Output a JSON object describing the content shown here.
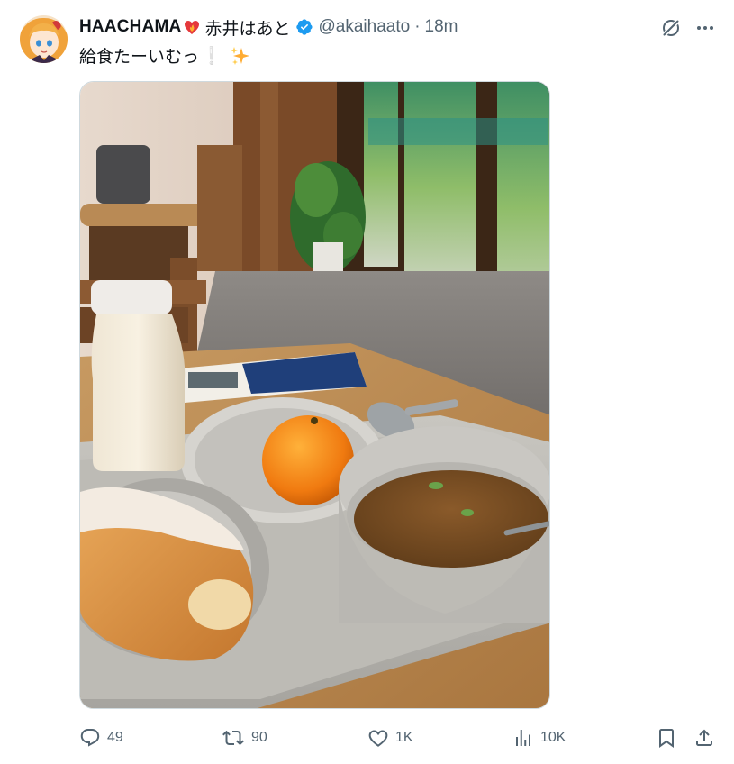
{
  "tweet": {
    "display_name": "HAACHAMA",
    "display_name_jp": "赤井はあと",
    "handle": "@akaihaato",
    "separator": "·",
    "time": "18m",
    "text": "給食たーいむっ",
    "text_exclaim": "❕"
  },
  "media": {
    "kind": "photo",
    "subject": "school-lunch tray with curry, sugared bread, mandarin orange and milk bottle"
  },
  "actions": {
    "replies": "49",
    "reposts": "90",
    "likes": "1K",
    "views": "10K"
  },
  "colors": {
    "text": "#0f1419",
    "secondary": "#536471",
    "verified": "#1d9bf0",
    "border": "#cfd9de"
  },
  "icons": [
    "avatar",
    "heart-fire-icon",
    "verified-badge-icon",
    "grok-icon",
    "more-icon",
    "sparkles-icon",
    "reply-icon",
    "repost-icon",
    "like-icon",
    "views-icon",
    "bookmark-icon",
    "share-icon"
  ]
}
